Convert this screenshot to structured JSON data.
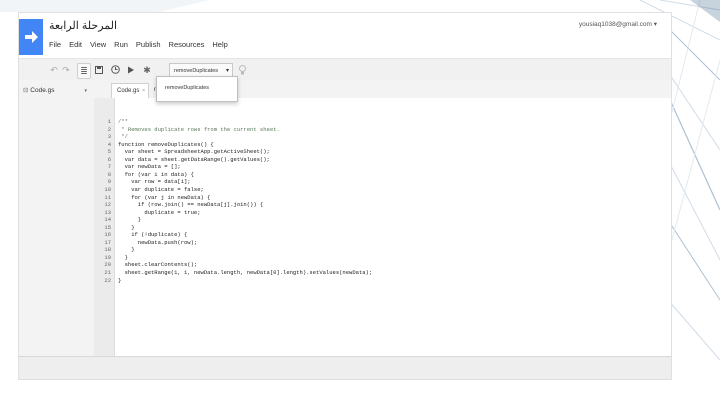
{
  "header": {
    "title": "المرحلة الرابعة",
    "account": "yousiaq1038@gmail.com ▾"
  },
  "menu": [
    "File",
    "Edit",
    "View",
    "Run",
    "Publish",
    "Resources",
    "Help"
  ],
  "toolbar": {
    "function_select": "removeDuplicates",
    "dropdown_option": "removeDuplicates"
  },
  "sidebar": {
    "file_name": "Code.gs"
  },
  "tabs": {
    "active": "Code.gs",
    "active_close": "×",
    "second": "removeDuplicates"
  },
  "editor": {
    "lines": [
      {
        "n": "1",
        "text": "/**",
        "type": "comment"
      },
      {
        "n": "2",
        "text": " * Removes duplicate rows from the current sheet.",
        "type": "comment"
      },
      {
        "n": "3",
        "text": " */",
        "type": "comment"
      },
      {
        "n": "4",
        "text": "function removeDuplicates() {",
        "type": "code"
      },
      {
        "n": "5",
        "text": "  var sheet = SpreadsheetApp.getActiveSheet();",
        "type": "code"
      },
      {
        "n": "6",
        "text": "  var data = sheet.getDataRange().getValues();",
        "type": "code"
      },
      {
        "n": "7",
        "text": "  var newData = [];",
        "type": "code"
      },
      {
        "n": "8",
        "text": "  for (var i in data) {",
        "type": "code"
      },
      {
        "n": "9",
        "text": "    var row = data[i];",
        "type": "code"
      },
      {
        "n": "10",
        "text": "    var duplicate = false;",
        "type": "code"
      },
      {
        "n": "11",
        "text": "    for (var j in newData) {",
        "type": "code"
      },
      {
        "n": "12",
        "text": "      if (row.join() == newData[j].join()) {",
        "type": "code"
      },
      {
        "n": "13",
        "text": "        duplicate = true;",
        "type": "code"
      },
      {
        "n": "14",
        "text": "      }",
        "type": "code"
      },
      {
        "n": "15",
        "text": "    }",
        "type": "code"
      },
      {
        "n": "16",
        "text": "    if (!duplicate) {",
        "type": "code"
      },
      {
        "n": "17",
        "text": "      newData.push(row);",
        "type": "code"
      },
      {
        "n": "18",
        "text": "    }",
        "type": "code"
      },
      {
        "n": "19",
        "text": "  }",
        "type": "code"
      },
      {
        "n": "20",
        "text": "  sheet.clearContents();",
        "type": "code"
      },
      {
        "n": "21",
        "text": "  sheet.getRange(1, 1, newData.length, newData[0].length).setValues(newData);",
        "type": "code"
      },
      {
        "n": "22",
        "text": "}",
        "type": "code"
      }
    ]
  },
  "colors": {
    "brand": "#4285f4",
    "slide_accent": "#1f4e79"
  },
  "icons": [
    "undo-icon",
    "redo-icon",
    "indent-icon",
    "save-icon",
    "clock-icon",
    "play-icon",
    "debug-icon",
    "lightbulb-icon"
  ]
}
